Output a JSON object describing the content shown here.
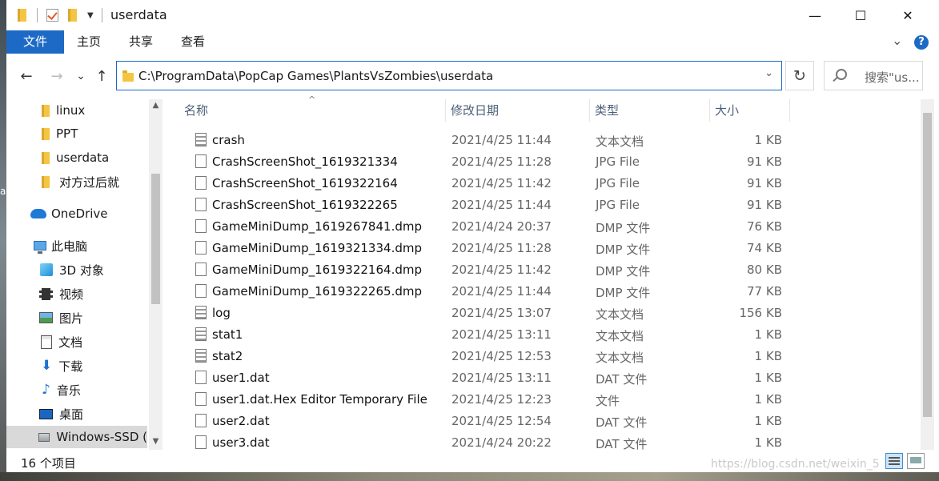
{
  "window": {
    "title": "userdata",
    "controls": {
      "minimize": "—",
      "maximize": "☐",
      "close": "✕"
    }
  },
  "ribbon": {
    "tabs": [
      {
        "label": "文件",
        "active": true
      },
      {
        "label": "主页",
        "active": false
      },
      {
        "label": "共享",
        "active": false
      },
      {
        "label": "查看",
        "active": false
      }
    ],
    "expand_glyph": "⌄",
    "help_glyph": "?"
  },
  "navigation": {
    "back": "←",
    "forward": "→",
    "recent": "⌄",
    "up": "↑",
    "address": "C:\\ProgramData\\PopCap Games\\PlantsVsZombies\\userdata",
    "address_dropdown": "⌄",
    "refresh": "↻",
    "search_placeholder": "搜索\"us..."
  },
  "nav_pane": {
    "items": [
      {
        "label": "linux",
        "icon": "folder-icon"
      },
      {
        "label": "PPT",
        "icon": "folder-icon"
      },
      {
        "label": "userdata",
        "icon": "folder-icon"
      },
      {
        "label": "对方过后就",
        "icon": "folder-icon"
      },
      {
        "label": "OneDrive",
        "icon": "cloud-icon"
      },
      {
        "label": "此电脑",
        "icon": "computer-icon"
      },
      {
        "label": "3D 对象",
        "icon": "cube-icon"
      },
      {
        "label": "视频",
        "icon": "video-icon"
      },
      {
        "label": "图片",
        "icon": "picture-icon"
      },
      {
        "label": "文档",
        "icon": "document-icon"
      },
      {
        "label": "下载",
        "icon": "download-icon"
      },
      {
        "label": "音乐",
        "icon": "music-icon"
      },
      {
        "label": "桌面",
        "icon": "desktop-icon"
      },
      {
        "label": "Windows-SSD (",
        "icon": "drive-icon",
        "selected": true
      }
    ]
  },
  "file_list": {
    "columns": [
      "名称",
      "修改日期",
      "类型",
      "大小"
    ],
    "sort_glyph": "^",
    "rows": [
      {
        "name": "crash",
        "date": "2021/4/25 11:44",
        "type": "文本文档",
        "size": "1 KB",
        "icon": "text-file-icon"
      },
      {
        "name": "CrashScreenShot_1619321334",
        "date": "2021/4/25 11:28",
        "type": "JPG File",
        "size": "91 KB",
        "icon": "file-icon"
      },
      {
        "name": "CrashScreenShot_1619322164",
        "date": "2021/4/25 11:42",
        "type": "JPG File",
        "size": "91 KB",
        "icon": "file-icon"
      },
      {
        "name": "CrashScreenShot_1619322265",
        "date": "2021/4/25 11:44",
        "type": "JPG File",
        "size": "91 KB",
        "icon": "file-icon"
      },
      {
        "name": "GameMiniDump_1619267841.dmp",
        "date": "2021/4/24 20:37",
        "type": "DMP 文件",
        "size": "76 KB",
        "icon": "file-icon"
      },
      {
        "name": "GameMiniDump_1619321334.dmp",
        "date": "2021/4/25 11:28",
        "type": "DMP 文件",
        "size": "74 KB",
        "icon": "file-icon"
      },
      {
        "name": "GameMiniDump_1619322164.dmp",
        "date": "2021/4/25 11:42",
        "type": "DMP 文件",
        "size": "80 KB",
        "icon": "file-icon"
      },
      {
        "name": "GameMiniDump_1619322265.dmp",
        "date": "2021/4/25 11:44",
        "type": "DMP 文件",
        "size": "77 KB",
        "icon": "file-icon"
      },
      {
        "name": "log",
        "date": "2021/4/25 13:07",
        "type": "文本文档",
        "size": "156 KB",
        "icon": "text-file-icon"
      },
      {
        "name": "stat1",
        "date": "2021/4/25 13:11",
        "type": "文本文档",
        "size": "1 KB",
        "icon": "text-file-icon"
      },
      {
        "name": "stat2",
        "date": "2021/4/25 12:53",
        "type": "文本文档",
        "size": "1 KB",
        "icon": "text-file-icon"
      },
      {
        "name": "user1.dat",
        "date": "2021/4/25 13:11",
        "type": "DAT 文件",
        "size": "1 KB",
        "icon": "file-icon"
      },
      {
        "name": "user1.dat.Hex Editor Temporary File",
        "date": "2021/4/25 12:23",
        "type": "文件",
        "size": "1 KB",
        "icon": "file-icon"
      },
      {
        "name": "user2.dat",
        "date": "2021/4/25 12:54",
        "type": "DAT 文件",
        "size": "1 KB",
        "icon": "file-icon"
      },
      {
        "name": "user3.dat",
        "date": "2021/4/24 20:22",
        "type": "DAT 文件",
        "size": "1 KB",
        "icon": "file-icon"
      }
    ]
  },
  "status_bar": {
    "item_count": "16 个项目"
  },
  "watermark": "https://blog.csdn.net/weixin_5",
  "edge_letter": "a",
  "colors": {
    "accent": "#1c6ac5",
    "selected_nav": "#d9d9d9",
    "header_text": "#4c607a"
  }
}
